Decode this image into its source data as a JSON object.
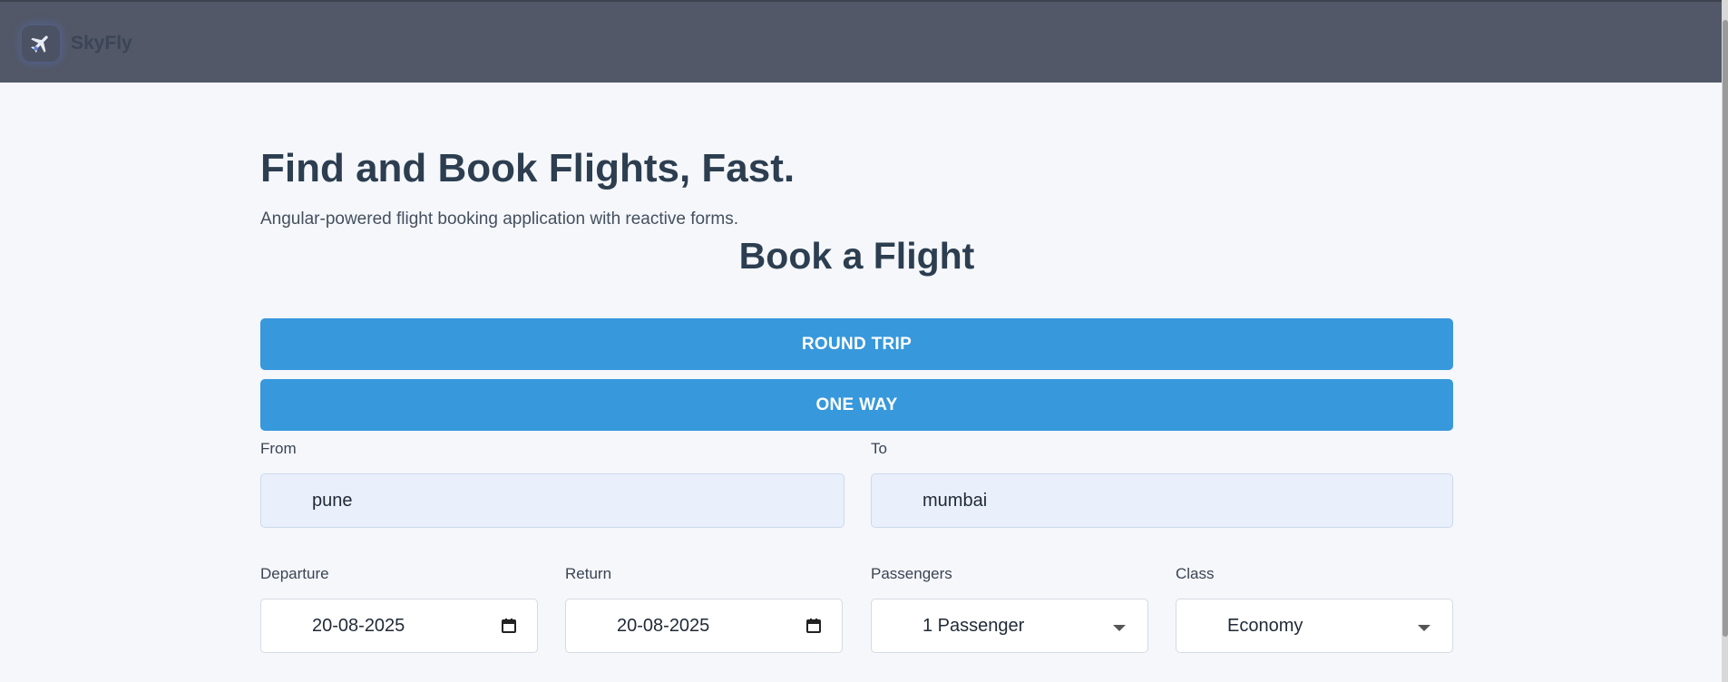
{
  "brand": {
    "name": "SkyFly",
    "icon": "airplane-icon"
  },
  "hero": {
    "title": "Find and Book Flights, Fast.",
    "subtitle": "Angular-powered flight booking application with reactive forms."
  },
  "booking": {
    "title": "Book a Flight",
    "trip_types": [
      "ROUND TRIP",
      "ONE WAY"
    ],
    "from": {
      "label": "From",
      "value": "pune"
    },
    "to": {
      "label": "To",
      "value": "mumbai"
    },
    "departure": {
      "label": "Departure",
      "value": "20-08-2025"
    },
    "return": {
      "label": "Return",
      "value": "20-08-2025"
    },
    "passengers": {
      "label": "Passengers",
      "value": "1 Passenger"
    },
    "class": {
      "label": "Class",
      "value": "Economy"
    }
  },
  "colors": {
    "navbar": "#525867",
    "primary": "#3798dc",
    "page_bg": "#f5f7fb",
    "input_bg": "#e9f0fb"
  }
}
